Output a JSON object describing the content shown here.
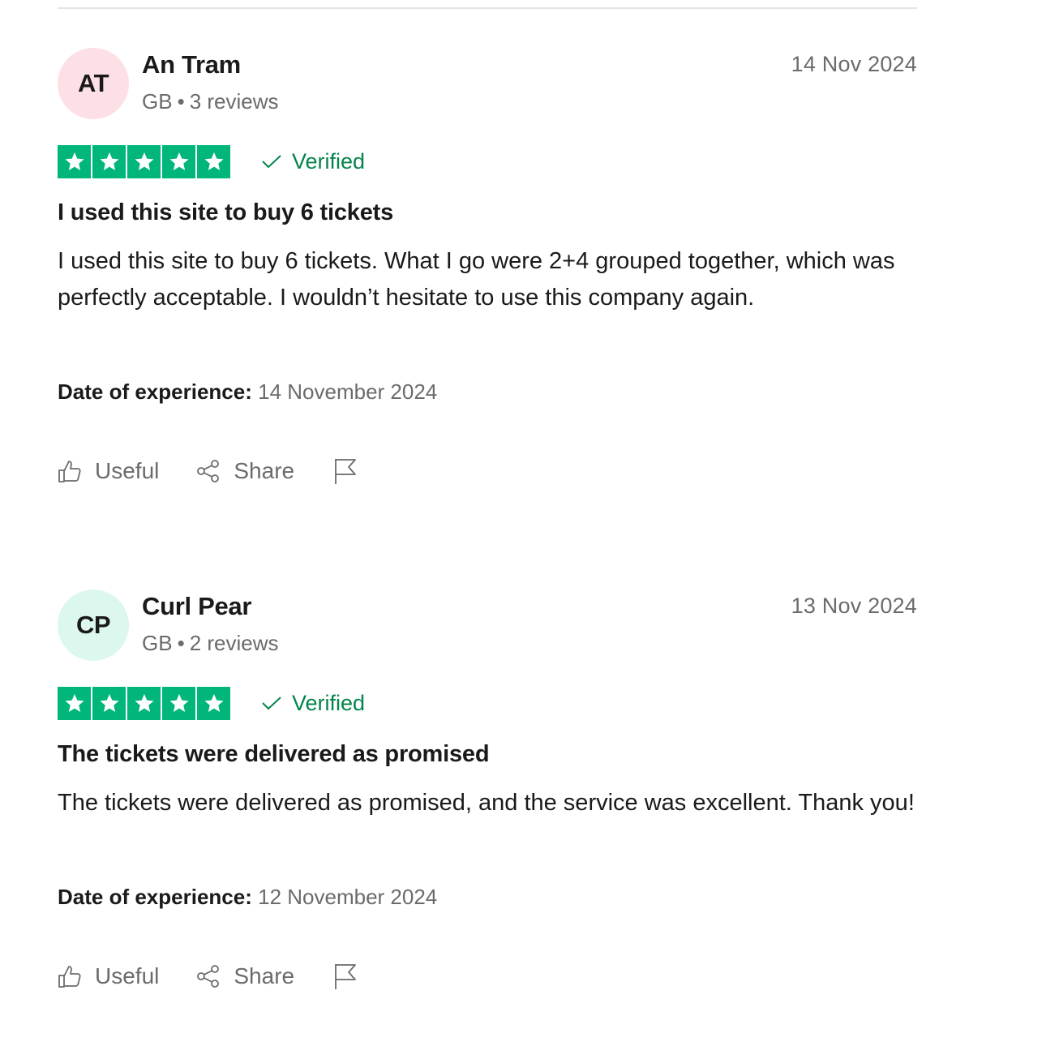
{
  "reviews": [
    {
      "initials": "AT",
      "avatar_color": "#fde0e6",
      "name": "An Tram",
      "country": "GB",
      "review_count": "3 reviews",
      "date": "14 Nov 2024",
      "stars": 5,
      "verified_label": "Verified",
      "title": "I used this site to buy 6 tickets",
      "body": "I used this site to buy 6 tickets. What I go were 2+4 grouped together, which was perfectly acceptable. I wouldn’t hesitate to use this company again.",
      "experience_label": "Date of experience:",
      "experience_date": "14 November 2024",
      "useful_label": "Useful",
      "share_label": "Share"
    },
    {
      "initials": "CP",
      "avatar_color": "#dcf7ee",
      "name": "Curl Pear",
      "country": "GB",
      "review_count": "2 reviews",
      "date": "13 Nov 2024",
      "stars": 5,
      "verified_label": "Verified",
      "title": "The tickets were delivered as promised",
      "body": "The tickets were delivered as promised, and the service was excellent. Thank you!",
      "experience_label": "Date of experience:",
      "experience_date": "12 November 2024",
      "useful_label": "Useful",
      "share_label": "Share"
    }
  ],
  "colors": {
    "star_green": "#00b67a",
    "verified_green": "#04844b",
    "muted_text": "#6b6b6b"
  },
  "icons": [
    "star-icon",
    "checkmark-icon",
    "thumbs-up-icon",
    "share-icon",
    "flag-icon"
  ]
}
